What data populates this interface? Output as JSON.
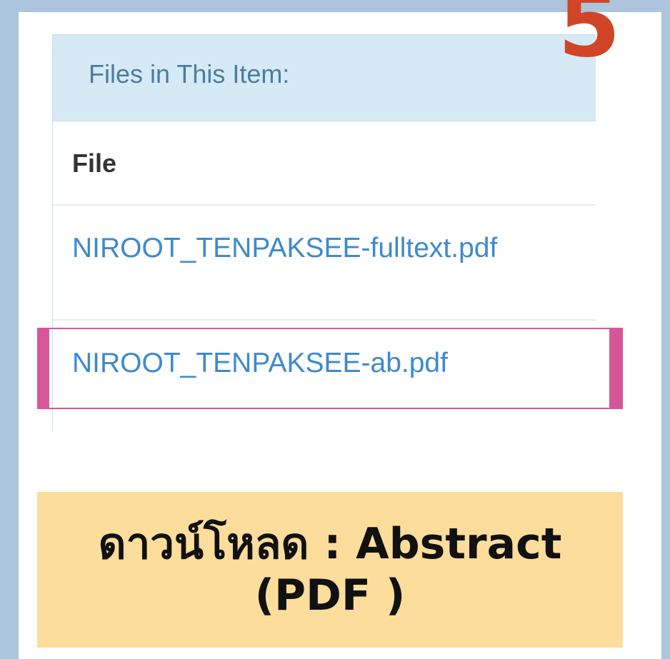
{
  "step": {
    "number": "5"
  },
  "panel": {
    "heading": "Files in This Item:",
    "column_header": "File",
    "files": [
      {
        "name": "NIROOT_TENPAKSEE-fulltext.pdf",
        "highlighted": false
      },
      {
        "name": "NIROOT_TENPAKSEE-ab.pdf",
        "highlighted": true
      }
    ]
  },
  "caption": {
    "text": "ดาวน์โหลด : Abstract\n(PDF )"
  },
  "colors": {
    "background": "#adc4dd",
    "step_number": "#cf4526",
    "panel_heading_bg": "#d6eaf5",
    "link": "#3e8acb",
    "highlight": "#d65799",
    "caption_bg": "#fddd9c"
  }
}
